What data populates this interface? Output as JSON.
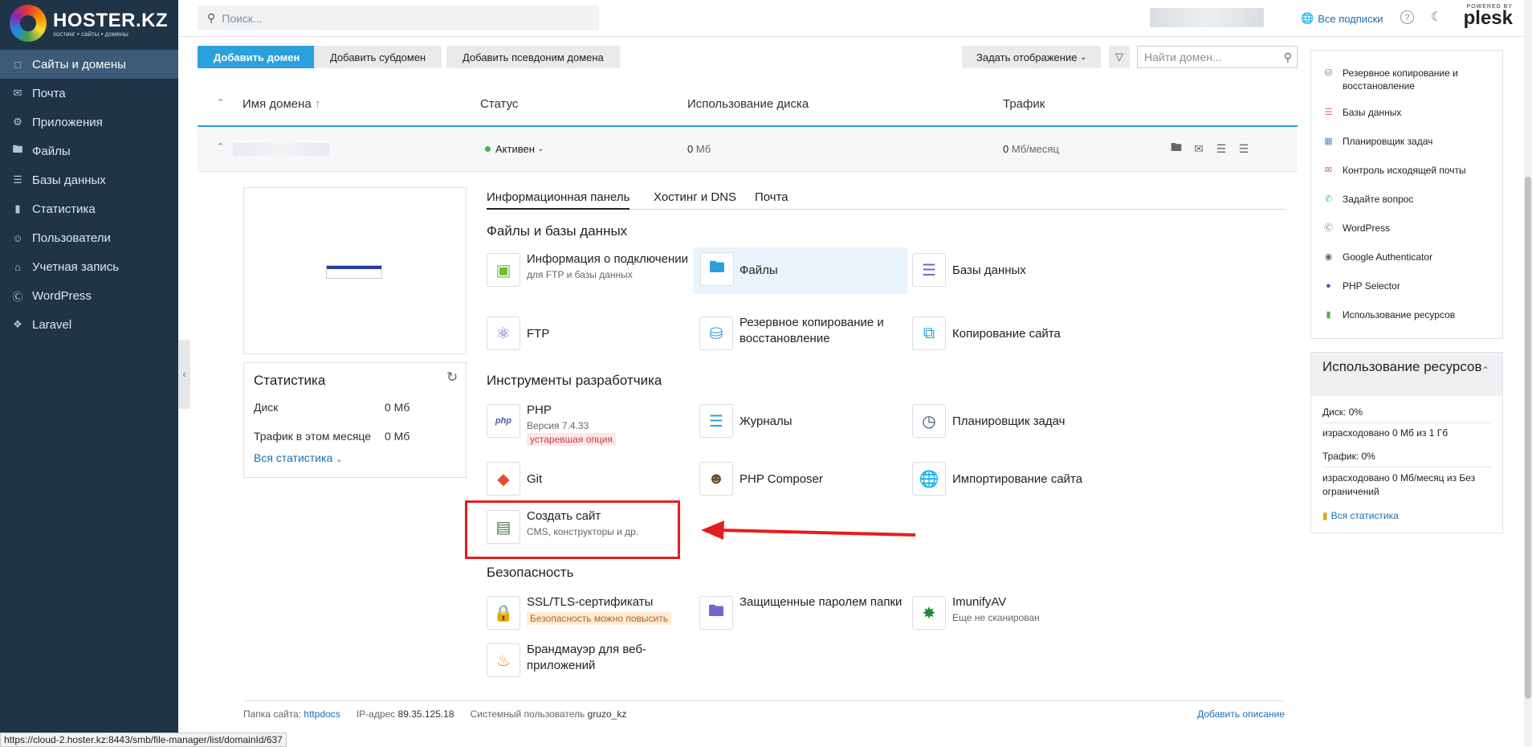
{
  "brand": {
    "name": "HOSTER.KZ",
    "tagline": "хостинг • сайты • домены"
  },
  "sidebar": {
    "items": [
      {
        "label": "Сайты и домены",
        "icon": "monitor-icon",
        "active": true
      },
      {
        "label": "Почта",
        "icon": "mail-icon"
      },
      {
        "label": "Приложения",
        "icon": "gear-icon"
      },
      {
        "label": "Файлы",
        "icon": "folder-icon"
      },
      {
        "label": "Базы данных",
        "icon": "layers-icon"
      },
      {
        "label": "Статистика",
        "icon": "bar-chart-icon"
      },
      {
        "label": "Пользователи",
        "icon": "user-icon"
      },
      {
        "label": "Учетная запись",
        "icon": "bank-icon"
      },
      {
        "label": "WordPress",
        "icon": "wordpress-icon"
      },
      {
        "label": "Laravel",
        "icon": "laravel-icon"
      }
    ]
  },
  "topbar": {
    "search_placeholder": "Поиск...",
    "subscriptions": "Все подписки",
    "powered": "POWERED BY",
    "plesk": "plesk"
  },
  "toolbar": {
    "add_domain": "Добавить домен",
    "add_subdomain": "Добавить субдомен",
    "add_alias": "Добавить псевдоним домена",
    "display": "Задать отображение",
    "find_placeholder": "Найти домен..."
  },
  "table": {
    "col_name": "Имя домена",
    "col_status": "Статус",
    "col_disk": "Использование диска",
    "col_traffic": "Трафик"
  },
  "domain": {
    "status": "Активен",
    "disk_value": "0",
    "disk_unit": "Мб",
    "traffic_value": "0",
    "traffic_unit": "Мб/месяц"
  },
  "stats": {
    "title": "Статистика",
    "disk_label": "Диск",
    "disk_value": "0 Мб",
    "traffic_label": "Трафик в этом месяце",
    "traffic_value": "0 Мб",
    "all": "Вся статистика"
  },
  "tabs": [
    "Информационная панель",
    "Хостинг и DNS",
    "Почта"
  ],
  "sections": {
    "files": "Файлы и базы данных",
    "dev": "Инструменты разработчика",
    "security": "Безопасность"
  },
  "tools": {
    "conn": {
      "name": "Информация о подключении",
      "sub": "для FTP и базы данных"
    },
    "files": {
      "name": "Файлы"
    },
    "databases": {
      "name": "Базы данных"
    },
    "ftp": {
      "name": "FTP"
    },
    "backup": {
      "name": "Резервное копирование и восстановление"
    },
    "copy": {
      "name": "Копирование сайта"
    },
    "php": {
      "name": "PHP",
      "sub": "Версия 7.4.33",
      "badge": "устаревшая опция"
    },
    "logs": {
      "name": "Журналы"
    },
    "scheduler": {
      "name": "Планировщик задач"
    },
    "git": {
      "name": "Git"
    },
    "composer": {
      "name": "PHP Composer"
    },
    "import": {
      "name": "Импортирование сайта"
    },
    "create": {
      "name": "Создать сайт",
      "sub": "CMS, конструкторы и др."
    },
    "ssl": {
      "name": "SSL/TLS-сертификаты",
      "badge": "Безопасность можно повысить"
    },
    "protected": {
      "name": "Защищенные паролем папки"
    },
    "imunify": {
      "name": "ImunifyAV",
      "sub": "Еще не сканирован"
    },
    "waf": {
      "name": "Брандмауэр для веб-приложений"
    }
  },
  "footer": {
    "folder_label": "Папка сайта:",
    "folder": "httpdocs",
    "ip_label": "IP-адрес",
    "ip": "89.35.125.18",
    "user_label": "Системный пользователь",
    "user": "gruzo_kz",
    "add_desc": "Добавить описание"
  },
  "right_panel": {
    "items": [
      {
        "label": "Резервное копирование и восстановление",
        "icon": "backup-icon",
        "color": "#5a7fa8"
      },
      {
        "label": "Базы данных",
        "icon": "database-icon",
        "color": "#e06a6a"
      },
      {
        "label": "Планировщик задач",
        "icon": "calendar-icon",
        "color": "#4a90d9"
      },
      {
        "label": "Контроль исходящей почты",
        "icon": "mail-icon",
        "color": "#e05050"
      },
      {
        "label": "Задайте вопрос",
        "icon": "whatsapp-icon",
        "color": "#25d366"
      },
      {
        "label": "WordPress",
        "icon": "wordpress-icon",
        "color": "#5f7f99"
      },
      {
        "label": "Google Authenticator",
        "icon": "authenticator-icon",
        "color": "#666"
      },
      {
        "label": "PHP Selector",
        "icon": "php-icon",
        "color": "#4a5b9c"
      },
      {
        "label": "Использование ресурсов",
        "icon": "chart-icon",
        "color": "#4caf50"
      }
    ]
  },
  "resources": {
    "title": "Использование ресурсов",
    "disk": "Диск: 0%",
    "disk_detail": "израсходовано 0 Мб из 1 Гб",
    "traffic": "Трафик: 0%",
    "traffic_detail": "израсходовано 0 Мб/месяц из Без ограничений",
    "all": "Вся статистика"
  },
  "status_url": "https://cloud-2.hoster.kz:8443/smb/file-manager/list/domainId/637",
  "colors": {
    "sidebar": "#1f3447",
    "accent": "#2aa0dd",
    "highlight_box": "#e41d1d"
  }
}
